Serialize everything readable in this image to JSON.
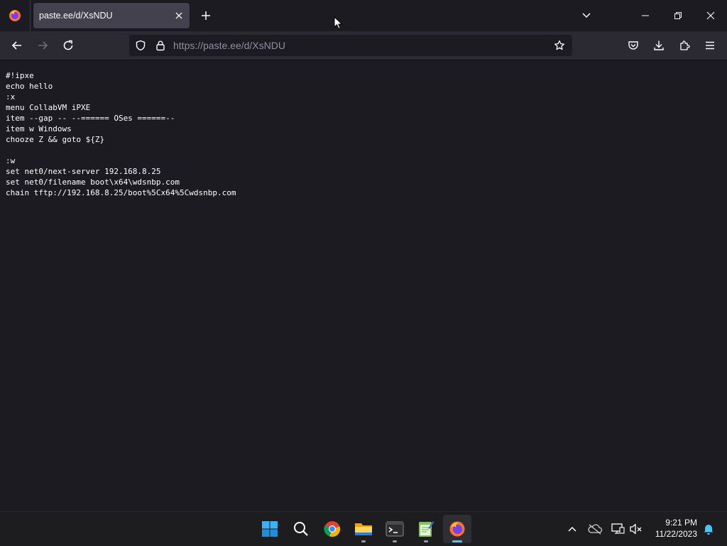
{
  "browser": {
    "tab": {
      "title": "paste.ee/d/XsNDU"
    },
    "url": "https://paste.ee/d/XsNDU"
  },
  "paste": {
    "lines": [
      "#!ipxe",
      "echo hello",
      ":x",
      "menu CollabVM iPXE",
      "item --gap -- --====== OSes ======--",
      "item w Windows",
      "chooze Z && goto ${Z}",
      "",
      ":w",
      "set net0/next-server 192.168.8.25",
      "set net0/filename boot\\x64\\wdsnbp.com",
      "chain tftp://192.168.8.25/boot%5Cx64%5Cwdsnbp.com"
    ]
  },
  "taskbar": {
    "time": "9:21 PM",
    "date": "11/22/2023"
  },
  "icons": {
    "tabbar": [
      "firefox-menu-icon",
      "close-icon",
      "plus-icon",
      "chevron-down-icon",
      "minimize-icon",
      "restore-icon",
      "close-icon"
    ],
    "navbar": [
      "back-arrow-icon",
      "forward-arrow-icon",
      "reload-icon",
      "shield-icon",
      "lock-icon",
      "star-icon",
      "pocket-icon",
      "download-icon",
      "extensions-icon",
      "hamburger-menu-icon"
    ],
    "taskbar": [
      "windows-start-icon",
      "search-icon",
      "chrome-icon",
      "file-explorer-icon",
      "terminal-icon",
      "notepad-icon",
      "firefox-icon",
      "chevron-up-icon",
      "onedrive-offline-icon",
      "network-icon",
      "volume-muted-icon",
      "bell-icon"
    ]
  },
  "colors": {
    "chrome_bg": "#1c1b22",
    "toolbar_bg": "#2b2a33",
    "active_tab": "#42414d",
    "accent": "#4cc2ff"
  }
}
